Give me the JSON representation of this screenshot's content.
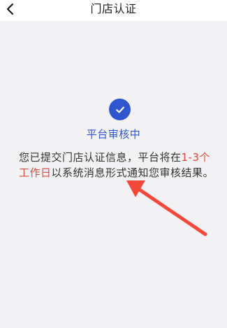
{
  "header": {
    "title": "门店认证",
    "back_icon": "chevron-left-icon"
  },
  "status": {
    "icon": "check-circle-icon",
    "icon_color": "#2f55cf",
    "title": "平台审核中"
  },
  "message": {
    "prefix": "您已提交门店认证信息，平台将在",
    "highlight": "1-3个工作日",
    "suffix": "以系统消息形式通知您审核结果。",
    "highlight_color": "#e0493c"
  },
  "annotation": {
    "arrow_color": "#f4483b"
  }
}
